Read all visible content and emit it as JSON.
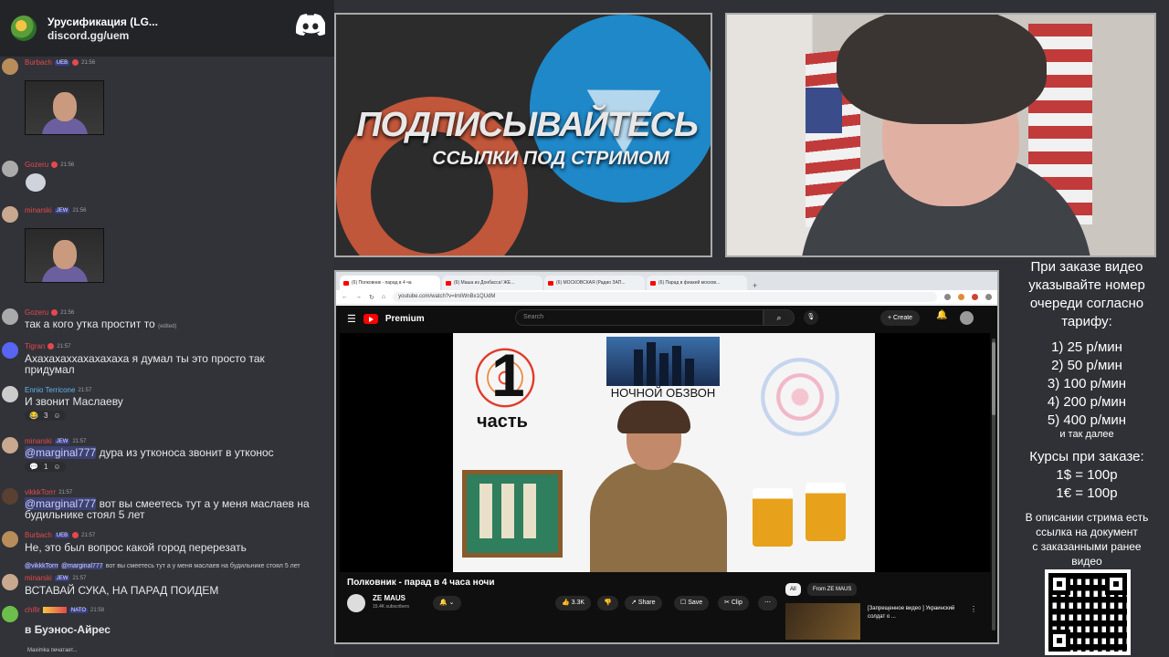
{
  "server": {
    "title": "Урусификация (LG...",
    "invite": "discord.gg/uem"
  },
  "messages": [
    {
      "user": "Burbach",
      "badge": "UEB",
      "time": "21:56",
      "color": "#e5484d"
    },
    {
      "user": "Gozeru",
      "time": "21:56",
      "color": "#e5484d"
    },
    {
      "user": "minarski",
      "badge": "JEW",
      "time": "21:56",
      "color": "#e5484d"
    },
    {
      "user": "Gozeru",
      "time": "21:56",
      "color": "#e5484d",
      "text": "так а кого утка простит то",
      "edited": "(edited)"
    },
    {
      "user": "Tigran",
      "time": "21:57",
      "color": "#e5484d",
      "text": "Ахахахаххахахахаха я думал ты это просто так",
      "text2": "придумал"
    },
    {
      "user": "Ennio Terricone",
      "time": "21:57",
      "color": "#63b3ed",
      "text": "И звонит Маслаеву",
      "reaction": "3"
    },
    {
      "user": "minarski",
      "badge": "JEW",
      "time": "21:57",
      "color": "#e5484d",
      "mention": "@marginal777",
      "text": "дура из утконоса звонит в утконос",
      "reaction": "1"
    },
    {
      "user": "vikkkTorrr",
      "time": "21:57",
      "color": "#e5484d",
      "mention": "@marginal777",
      "text": "вот вы смеетесь тут а у меня маслаев на",
      "text2": "будильнике стоял 5 лет"
    },
    {
      "user": "Burbach",
      "badge": "UEB",
      "time": "21:57",
      "color": "#e5484d",
      "text": "Не, это был вопрос какой город перерезать"
    },
    {
      "user": "minarski",
      "badge": "JEW",
      "time": "21:57",
      "color": "#e5484d",
      "reply_user": "@vikkkTorrr",
      "reply_mention": "@marginal777",
      "reply": "вот вы смеетесь тут а у меня маслаев на будильнике стоял 5 лет",
      "text": "ВСТАВАЙ СУКА, НА ПАРАД ПОИДЕМ"
    },
    {
      "user": "chifir",
      "badge": "NATO",
      "time": "21:58",
      "color": "#e5484d",
      "text": "в Буэнос-Айрес"
    }
  ],
  "typing": "Maximka печатает...",
  "promo": {
    "title": "ПОДПИСЫВАЙТЕСЬ",
    "subtitle": "ССЫЛКИ ПОД СТРИМОМ"
  },
  "prices": {
    "intro": [
      "При заказе видео",
      "указывайте номер",
      "очереди согласно",
      "тарифу:"
    ],
    "tiers": [
      "1) 25 р/мин",
      "2) 50 р/мин",
      "3) 100 р/мин",
      "4) 200 р/мин",
      "5) 400 р/мин"
    ],
    "more": "и так далее",
    "rates_title": "Курсы при заказе:",
    "rates": [
      "1$ = 100р",
      "1€ = 100р"
    ],
    "note": [
      "В описании стрима есть",
      "ссылка на документ",
      "с заказанными ранее",
      "видео"
    ]
  },
  "browser": {
    "tabs": [
      "(6) Полковник - парад в 4 ча",
      "(6) Маша из Донбасса! ЖЕ...",
      "(6) МОСКОВСКАЯ (Радио ЗАП...",
      "(6) Парад в фиакей москов..."
    ],
    "url": "youtube.com/watch?v=lmIWnBx1QUdM"
  },
  "youtube": {
    "brand": "Premium",
    "search_placeholder": "Search",
    "create": "Create",
    "notif_count": "9+",
    "thumb_number": "1",
    "thumb_part": "часть",
    "thumb_caption": "НОЧНОЙ ОБЗВОН",
    "title": "Полковник - парад в 4 часа ночи",
    "channel": "ZE MAUS",
    "subs": "15.4K subscribers",
    "likes": "3.3K",
    "share": "Share",
    "save": "Save",
    "clip": "Clip",
    "chip_all": "All",
    "chip_from": "From ZE MAUS",
    "related_title": "[Запрещенное видео ] Украинский солдат о ..."
  }
}
